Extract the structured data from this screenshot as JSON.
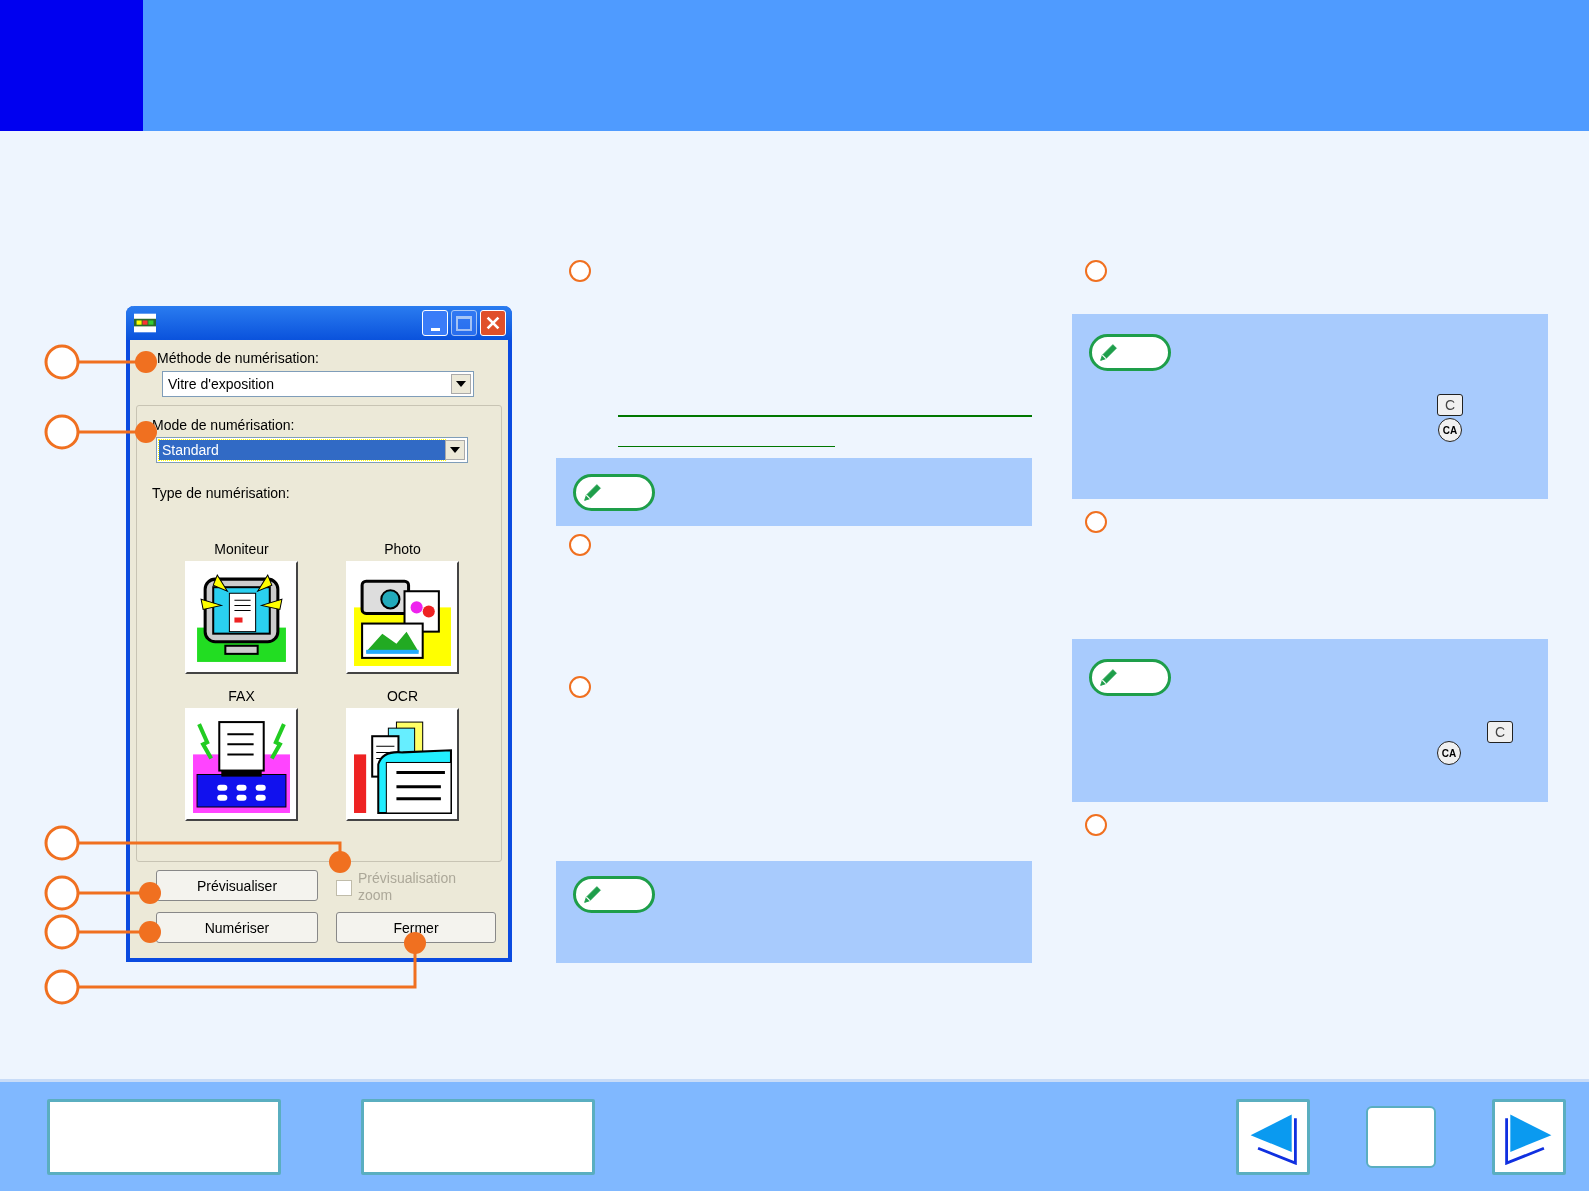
{
  "dialog": {
    "method_label": "Méthode de numérisation:",
    "method_value": "Vitre d'exposition",
    "mode_label": "Mode de numérisation:",
    "mode_value": "Standard",
    "mode_focused": true,
    "type_label": "Type de numérisation:",
    "scan_types": [
      {
        "label": "Moniteur",
        "kind": "monitor"
      },
      {
        "label": "Photo",
        "kind": "photo"
      },
      {
        "label": "FAX",
        "kind": "fax"
      },
      {
        "label": "OCR",
        "kind": "ocr"
      }
    ],
    "preview_button": "Prévisualiser",
    "scan_button": "Numériser",
    "close_button": "Fermer",
    "zoom_checkbox": {
      "label": "Prévisualisation zoom",
      "checked": false,
      "disabled": true
    }
  },
  "right_notes": [
    {
      "keys": [
        {
          "label": "C",
          "kind": "square"
        },
        {
          "label": "CA",
          "kind": "round"
        }
      ]
    },
    {
      "keys": [
        {
          "label": "C",
          "kind": "square"
        },
        {
          "label": "CA",
          "kind": "round"
        }
      ]
    }
  ]
}
